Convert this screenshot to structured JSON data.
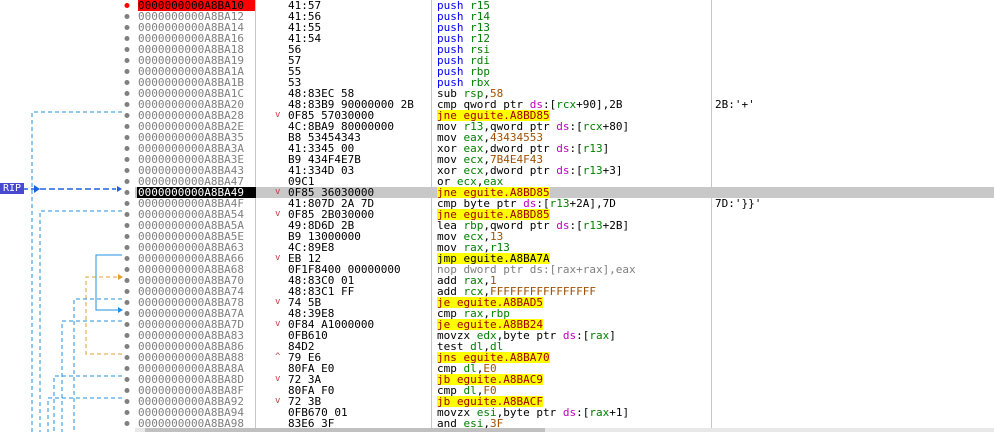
{
  "rip_label": "RIP",
  "colors": {
    "selected_row": "#c8c8c8",
    "jump_highlight": "#ffff00",
    "breakpoint": "#ff0000",
    "rip": "#4848d0"
  },
  "rows": [
    {
      "addr": "0000000000A8BA10",
      "bytes": "41:57",
      "mn": "push",
      "mc": "m-push",
      "ops": [
        [
          "r15",
          "reg"
        ]
      ],
      "cmt": "",
      "dot": "red",
      "bp": true
    },
    {
      "addr": "0000000000A8BA12",
      "bytes": "41:56",
      "mn": "push",
      "mc": "m-push",
      "ops": [
        [
          "r14",
          "reg"
        ]
      ],
      "cmt": ""
    },
    {
      "addr": "0000000000A8BA14",
      "bytes": "41:55",
      "mn": "push",
      "mc": "m-push",
      "ops": [
        [
          "r13",
          "reg"
        ]
      ],
      "cmt": ""
    },
    {
      "addr": "0000000000A8BA16",
      "bytes": "41:54",
      "mn": "push",
      "mc": "m-push",
      "ops": [
        [
          "r12",
          "reg"
        ]
      ],
      "cmt": ""
    },
    {
      "addr": "0000000000A8BA18",
      "bytes": "56",
      "mn": "push",
      "mc": "m-push",
      "ops": [
        [
          "rsi",
          "reg"
        ]
      ],
      "cmt": ""
    },
    {
      "addr": "0000000000A8BA19",
      "bytes": "57",
      "mn": "push",
      "mc": "m-push",
      "ops": [
        [
          "rdi",
          "reg"
        ]
      ],
      "cmt": ""
    },
    {
      "addr": "0000000000A8BA1A",
      "bytes": "55",
      "mn": "push",
      "mc": "m-push",
      "ops": [
        [
          "rbp",
          "reg"
        ]
      ],
      "cmt": ""
    },
    {
      "addr": "0000000000A8BA1B",
      "bytes": "53",
      "mn": "push",
      "mc": "m-push",
      "ops": [
        [
          "rbx",
          "reg"
        ]
      ],
      "cmt": ""
    },
    {
      "addr": "0000000000A8BA1C",
      "bytes": "48:83EC 58",
      "mn": "sub",
      "mc": "m-black",
      "ops": [
        [
          "rsp",
          "reg"
        ],
        [
          ",",
          ""
        ],
        [
          "58",
          "num"
        ]
      ],
      "cmt": ""
    },
    {
      "addr": "0000000000A8BA20",
      "bytes": "48:83B9 90000000 2B",
      "mn": "cmp",
      "mc": "m-black",
      "ops": [
        [
          "qword ptr ",
          ""
        ],
        [
          "ds",
          "seg"
        ],
        [
          ":[",
          ""
        ],
        [
          "rcx",
          "reg"
        ],
        [
          "+90],2B",
          ""
        ]
      ],
      "cmt": "2B:'+'"
    },
    {
      "addr": "0000000000A8BA28",
      "bytes": "0F85 57030000",
      "mn": "jne eguite.A8BD85",
      "mc": "m-jcc",
      "ops": [],
      "cmt": "",
      "marker": "v"
    },
    {
      "addr": "0000000000A8BA2E",
      "bytes": "4C:8BA9 80000000",
      "mn": "mov",
      "mc": "m-black",
      "ops": [
        [
          "r13",
          "reg"
        ],
        [
          ",qword ptr ",
          ""
        ],
        [
          "ds",
          "seg"
        ],
        [
          ":[",
          ""
        ],
        [
          "rcx",
          "reg"
        ],
        [
          "+80]",
          ""
        ]
      ],
      "cmt": ""
    },
    {
      "addr": "0000000000A8BA35",
      "bytes": "B8 53454343",
      "mn": "mov",
      "mc": "m-black",
      "ops": [
        [
          "eax",
          "reg"
        ],
        [
          ",",
          ""
        ],
        [
          "43434553",
          "num"
        ]
      ],
      "cmt": ""
    },
    {
      "addr": "0000000000A8BA3A",
      "bytes": "41:3345 00",
      "mn": "xor",
      "mc": "m-black",
      "ops": [
        [
          "eax",
          "reg"
        ],
        [
          ",dword ptr ",
          ""
        ],
        [
          "ds",
          "seg"
        ],
        [
          ":[",
          ""
        ],
        [
          "r13",
          "reg"
        ],
        [
          "]",
          ""
        ]
      ],
      "cmt": ""
    },
    {
      "addr": "0000000000A8BA3E",
      "bytes": "B9 434F4E7B",
      "mn": "mov",
      "mc": "m-black",
      "ops": [
        [
          "ecx",
          "reg"
        ],
        [
          ",",
          ""
        ],
        [
          "7B4E4F43",
          "num"
        ]
      ],
      "cmt": ""
    },
    {
      "addr": "0000000000A8BA43",
      "bytes": "41:334D 03",
      "mn": "xor",
      "mc": "m-black",
      "ops": [
        [
          "ecx",
          "reg"
        ],
        [
          ",dword ptr ",
          ""
        ],
        [
          "ds",
          "seg"
        ],
        [
          ":[",
          ""
        ],
        [
          "r13",
          "reg"
        ],
        [
          "+3]",
          ""
        ]
      ],
      "cmt": ""
    },
    {
      "addr": "0000000000A8BA47",
      "bytes": "09C1",
      "mn": "or",
      "mc": "m-black",
      "ops": [
        [
          "ecx",
          "reg"
        ],
        [
          ",",
          ""
        ],
        [
          "eax",
          "reg"
        ]
      ],
      "cmt": ""
    },
    {
      "addr": "0000000000A8BA49",
      "bytes": "0F85 36030000",
      "mn": "jne eguite.A8BD85",
      "mc": "m-jcc",
      "ops": [],
      "cmt": "",
      "sel": true,
      "marker": "v"
    },
    {
      "addr": "0000000000A8BA4F",
      "bytes": "41:807D 2A 7D",
      "mn": "cmp",
      "mc": "m-black",
      "ops": [
        [
          "byte ptr ",
          ""
        ],
        [
          "ds",
          "seg"
        ],
        [
          ":[",
          ""
        ],
        [
          "r13",
          "reg"
        ],
        [
          "+2A],7D",
          ""
        ]
      ],
      "cmt": "7D:'}}'"
    },
    {
      "addr": "0000000000A8BA54",
      "bytes": "0F85 2B030000",
      "mn": "jne eguite.A8BD85",
      "mc": "m-jcc",
      "ops": [],
      "cmt": "",
      "marker": "v"
    },
    {
      "addr": "0000000000A8BA5A",
      "bytes": "49:8D6D 2B",
      "mn": "lea",
      "mc": "m-black",
      "ops": [
        [
          "rbp",
          "reg"
        ],
        [
          ",qword ptr ",
          ""
        ],
        [
          "ds",
          "seg"
        ],
        [
          ":[",
          ""
        ],
        [
          "r13",
          "reg"
        ],
        [
          "+2B]",
          ""
        ]
      ],
      "cmt": ""
    },
    {
      "addr": "0000000000A8BA5E",
      "bytes": "B9 13000000",
      "mn": "mov",
      "mc": "m-black",
      "ops": [
        [
          "ecx",
          "reg"
        ],
        [
          ",",
          ""
        ],
        [
          "13",
          "num"
        ]
      ],
      "cmt": ""
    },
    {
      "addr": "0000000000A8BA63",
      "bytes": "4C:89E8",
      "mn": "mov",
      "mc": "m-black",
      "ops": [
        [
          "rax",
          "reg"
        ],
        [
          ",",
          ""
        ],
        [
          "r13",
          "reg"
        ]
      ],
      "cmt": ""
    },
    {
      "addr": "0000000000A8BA66",
      "bytes": "EB 12",
      "mn": "jmp eguite.A8BA7A",
      "mc": "m-jmp",
      "ops": [],
      "cmt": "",
      "marker": "v"
    },
    {
      "addr": "0000000000A8BA68",
      "bytes": "0F1F8400 00000000",
      "mn": "nop dword ptr ds:[rax+rax],eax",
      "mc": "m-gray",
      "ops": [],
      "cmt": ""
    },
    {
      "addr": "0000000000A8BA70",
      "bytes": "48:83C0 01",
      "mn": "add",
      "mc": "m-black",
      "ops": [
        [
          "rax",
          "reg"
        ],
        [
          ",",
          ""
        ],
        [
          "1",
          "num"
        ]
      ],
      "cmt": ""
    },
    {
      "addr": "0000000000A8BA74",
      "bytes": "48:83C1 FF",
      "mn": "add",
      "mc": "m-black",
      "ops": [
        [
          "rcx",
          "reg"
        ],
        [
          ",",
          ""
        ],
        [
          "FFFFFFFFFFFFFFFF",
          "num"
        ]
      ],
      "cmt": ""
    },
    {
      "addr": "0000000000A8BA78",
      "bytes": "74 5B",
      "mn": "je eguite.A8BAD5",
      "mc": "m-jcc",
      "ops": [],
      "cmt": "",
      "marker": "v"
    },
    {
      "addr": "0000000000A8BA7A",
      "bytes": "48:39E8",
      "mn": "cmp",
      "mc": "m-black",
      "ops": [
        [
          "rax",
          "reg"
        ],
        [
          ",",
          ""
        ],
        [
          "rbp",
          "reg"
        ]
      ],
      "cmt": ""
    },
    {
      "addr": "0000000000A8BA7D",
      "bytes": "0F84 A1000000",
      "mn": "je eguite.A8BB24",
      "mc": "m-jcc",
      "ops": [],
      "cmt": "",
      "marker": "v"
    },
    {
      "addr": "0000000000A8BA83",
      "bytes": "0FB610",
      "mn": "movzx",
      "mc": "m-black",
      "ops": [
        [
          "edx",
          "reg"
        ],
        [
          ",byte ptr ",
          ""
        ],
        [
          "ds",
          "seg"
        ],
        [
          ":[",
          ""
        ],
        [
          "rax",
          "reg"
        ],
        [
          "]",
          ""
        ]
      ],
      "cmt": ""
    },
    {
      "addr": "0000000000A8BA86",
      "bytes": "84D2",
      "mn": "test",
      "mc": "m-black",
      "ops": [
        [
          "dl",
          "reg"
        ],
        [
          ",",
          ""
        ],
        [
          "dl",
          "reg"
        ]
      ],
      "cmt": ""
    },
    {
      "addr": "0000000000A8BA88",
      "bytes": "79 E6",
      "mn": "jns eguite.A8BA70",
      "mc": "m-jcc",
      "ops": [],
      "cmt": "",
      "marker": "^"
    },
    {
      "addr": "0000000000A8BA8A",
      "bytes": "80FA E0",
      "mn": "cmp",
      "mc": "m-black",
      "ops": [
        [
          "dl",
          "reg"
        ],
        [
          ",",
          ""
        ],
        [
          "E0",
          "num"
        ]
      ],
      "cmt": ""
    },
    {
      "addr": "0000000000A8BA8D",
      "bytes": "72 3A",
      "mn": "jb eguite.A8BAC9",
      "mc": "m-jcc",
      "ops": [],
      "cmt": "",
      "marker": "v"
    },
    {
      "addr": "0000000000A8BA8F",
      "bytes": "80FA F0",
      "mn": "cmp",
      "mc": "m-black",
      "ops": [
        [
          "dl",
          "reg"
        ],
        [
          ",",
          ""
        ],
        [
          "F0",
          "num"
        ]
      ],
      "cmt": ""
    },
    {
      "addr": "0000000000A8BA92",
      "bytes": "72 3B",
      "mn": "jb eguite.A8BACF",
      "mc": "m-jcc",
      "ops": [],
      "cmt": "",
      "marker": "v"
    },
    {
      "addr": "0000000000A8BA94",
      "bytes": "0FB670 01",
      "mn": "movzx",
      "mc": "m-black",
      "ops": [
        [
          "esi",
          "reg"
        ],
        [
          ",byte ptr ",
          ""
        ],
        [
          "ds",
          "seg"
        ],
        [
          ":[",
          ""
        ],
        [
          "rax",
          "reg"
        ],
        [
          "+1]",
          ""
        ]
      ],
      "cmt": ""
    },
    {
      "addr": "0000000000A8BA98",
      "bytes": "83E6 3F",
      "mn": "and",
      "mc": "m-black",
      "ops": [
        [
          "esi",
          "reg"
        ],
        [
          ",",
          ""
        ],
        [
          "3F",
          "num"
        ]
      ],
      "cmt": ""
    }
  ]
}
